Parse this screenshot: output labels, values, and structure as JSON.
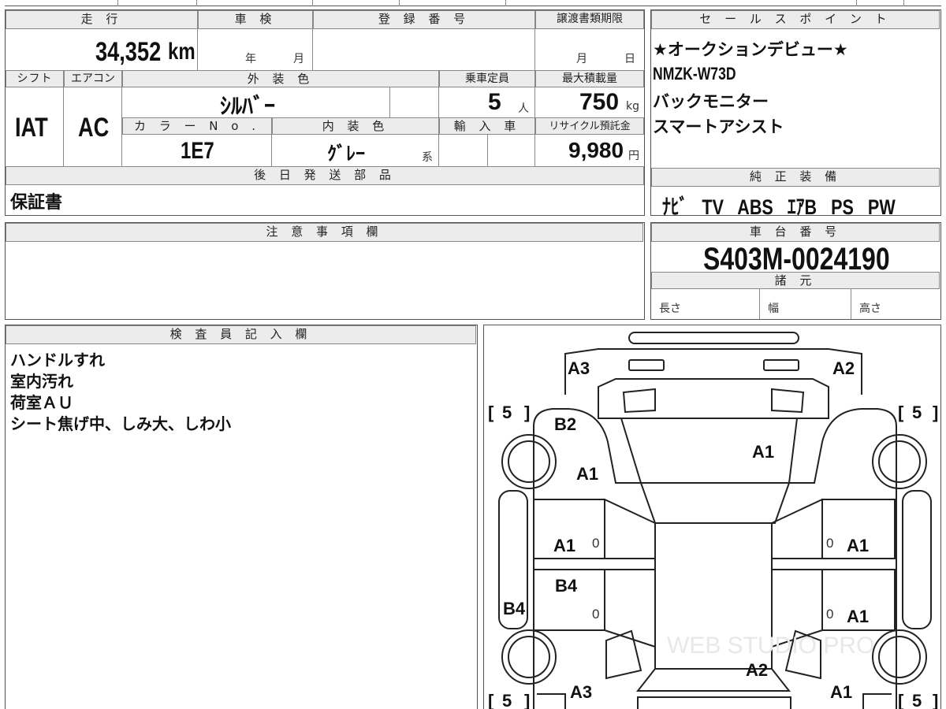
{
  "sheet": {
    "mileage": {
      "label": "走 行",
      "value": "34,352",
      "unit": "km"
    },
    "inspection": {
      "label": "車 検",
      "year_unit": "年",
      "month_unit": "月"
    },
    "registration": {
      "label": "登 録 番 号"
    },
    "transfer_deadline": {
      "label": "譲渡書類期限",
      "month_unit": "月",
      "day_unit": "日"
    },
    "shift": {
      "label": "シフト",
      "value": "IAT"
    },
    "aircon": {
      "label": "エアコン",
      "value": "AC"
    },
    "exterior_color": {
      "label": "外 装 色",
      "value": "ｼﾙﾊﾞｰ"
    },
    "capacity": {
      "label": "乗車定員",
      "value": "5",
      "unit": "人"
    },
    "max_load": {
      "label": "最大積載量",
      "value": "750",
      "unit": "kg"
    },
    "color_no": {
      "label": "カ ラ ー N o .",
      "value": "1E7"
    },
    "interior_color": {
      "label": "内 装 色",
      "value": "ｸﾞﾚｰ",
      "suffix": "系"
    },
    "import": {
      "label": "輸 入 車"
    },
    "recycle_fee": {
      "label": "リサイクル預託金",
      "value": "9,980",
      "unit": "円"
    },
    "later_parts": {
      "label": "後 日 発 送 部 品",
      "value": "保証書"
    },
    "notes": {
      "label": "注 意 事 項 欄"
    },
    "sales_points": {
      "label": "セ ー ル ス ポ イ ン ト",
      "lines": [
        "★オークションデビュー★",
        "NMZK-W73D",
        "バックモニター",
        "スマートアシスト"
      ]
    },
    "equipment": {
      "label": "純 正 装 備",
      "items": [
        "ﾅﾋﾞ",
        "TV",
        "ABS",
        "ｴｱB",
        "PS",
        "PW"
      ]
    },
    "chassis": {
      "label": "車 台 番 号",
      "value": "S403M-0024190"
    },
    "specs": {
      "label": "諸 元",
      "length": "長さ",
      "width": "幅",
      "height": "高さ"
    },
    "inspector": {
      "label": "検 査 員 記 入 欄",
      "lines": [
        "ハンドルすれ",
        "室内汚れ",
        "荷室ＡＵ",
        "シート焦げ中、しみ大、しわ小"
      ]
    }
  },
  "diagram": {
    "marks": {
      "front_left": "A3",
      "front_right": "A2",
      "hood_left": "B2",
      "windshield": "A1",
      "fender_left": "A1",
      "door_fl": "A1",
      "door_fr": "A1",
      "door_rl": "B4",
      "door_rr": "A1",
      "rocker_left": "B4",
      "rear_center": "A2",
      "rear_left": "A3",
      "rear_right": "A1"
    },
    "tires": {
      "fl": "5",
      "fr": "5",
      "rl": "5",
      "rr": "5"
    },
    "zeros": [
      "0",
      "0",
      "0",
      "0"
    ],
    "watermark": "WEB STUDIO PRO"
  }
}
